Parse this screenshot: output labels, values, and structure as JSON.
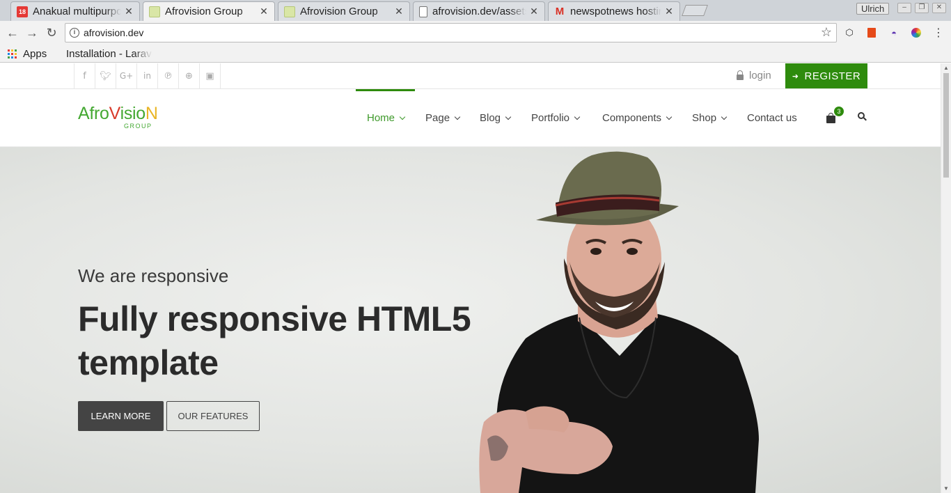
{
  "browser": {
    "tabs": [
      {
        "title": "Anakual multipurpose",
        "active": false,
        "favicon_color": "#e53935",
        "favicon_glyph": "18"
      },
      {
        "title": "Afrovision Group",
        "active": true,
        "favicon_color": "#cddc39",
        "favicon_glyph": ""
      },
      {
        "title": "Afrovision Group",
        "active": false,
        "favicon_color": "#cddc39",
        "favicon_glyph": ""
      },
      {
        "title": "afrovision.dev/assets",
        "active": false,
        "favicon_color": "#ffffff",
        "favicon_glyph": ""
      },
      {
        "title": "newspotnews hosting",
        "active": false,
        "favicon_color": "#ffffff",
        "favicon_glyph": "M"
      }
    ],
    "user": "Ulrich",
    "url": "afrovision.dev",
    "bookmarks": {
      "apps": "Apps",
      "item1": "Installation - Laravel"
    }
  },
  "site": {
    "accent_color": "#2e8b0d",
    "social_icons": [
      "facebook-icon",
      "twitter-icon",
      "google-plus-icon",
      "linkedin-icon",
      "pinterest-icon",
      "dribbble-icon",
      "instagram-icon"
    ],
    "login": "login",
    "register": "REGISTER",
    "logo": {
      "part1": "Afro",
      "part2": "V",
      "part3": "isio",
      "part4": "N",
      "group": "GROUP"
    },
    "menu": [
      {
        "label": "Home",
        "dropdown": true,
        "active": true
      },
      {
        "label": "Page",
        "dropdown": true
      },
      {
        "label": "Blog",
        "dropdown": true
      },
      {
        "label": "Portfolio",
        "dropdown": true
      },
      {
        "label": "Components",
        "dropdown": true
      },
      {
        "label": "Shop",
        "dropdown": true
      },
      {
        "label": "Contact us",
        "dropdown": false
      }
    ],
    "cart_count": "3",
    "hero": {
      "subtitle": "We are responsive",
      "title": "Fully responsive HTML5 template",
      "btn_primary": "LEARN MORE",
      "btn_secondary": "OUR FEATURES"
    }
  }
}
